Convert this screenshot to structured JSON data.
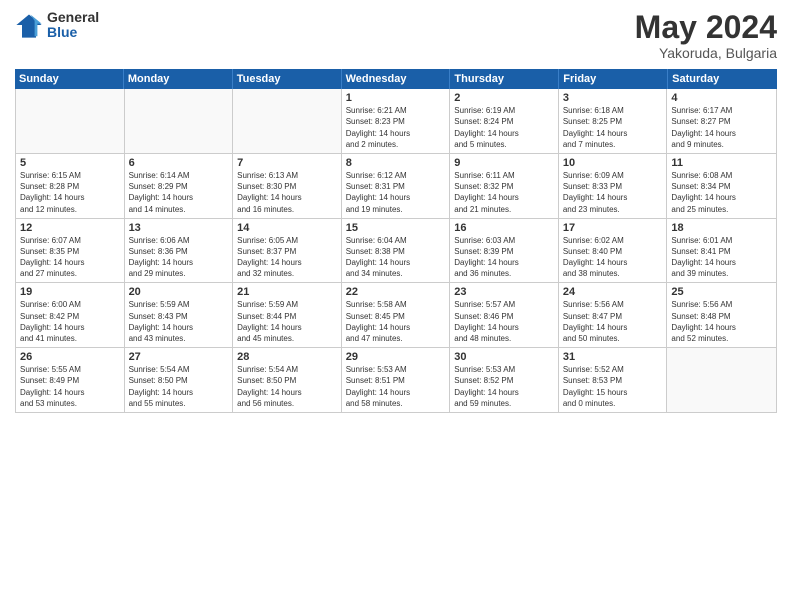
{
  "logo": {
    "general": "General",
    "blue": "Blue"
  },
  "title": "May 2024",
  "subtitle": "Yakoruda, Bulgaria",
  "days": [
    "Sunday",
    "Monday",
    "Tuesday",
    "Wednesday",
    "Thursday",
    "Friday",
    "Saturday"
  ],
  "weeks": [
    [
      {
        "day": "",
        "empty": true
      },
      {
        "day": "",
        "empty": true
      },
      {
        "day": "",
        "empty": true
      },
      {
        "day": "1",
        "line1": "Sunrise: 6:21 AM",
        "line2": "Sunset: 8:23 PM",
        "line3": "Daylight: 14 hours",
        "line4": "and 2 minutes."
      },
      {
        "day": "2",
        "line1": "Sunrise: 6:19 AM",
        "line2": "Sunset: 8:24 PM",
        "line3": "Daylight: 14 hours",
        "line4": "and 5 minutes."
      },
      {
        "day": "3",
        "line1": "Sunrise: 6:18 AM",
        "line2": "Sunset: 8:25 PM",
        "line3": "Daylight: 14 hours",
        "line4": "and 7 minutes."
      },
      {
        "day": "4",
        "line1": "Sunrise: 6:17 AM",
        "line2": "Sunset: 8:27 PM",
        "line3": "Daylight: 14 hours",
        "line4": "and 9 minutes."
      }
    ],
    [
      {
        "day": "5",
        "line1": "Sunrise: 6:15 AM",
        "line2": "Sunset: 8:28 PM",
        "line3": "Daylight: 14 hours",
        "line4": "and 12 minutes."
      },
      {
        "day": "6",
        "line1": "Sunrise: 6:14 AM",
        "line2": "Sunset: 8:29 PM",
        "line3": "Daylight: 14 hours",
        "line4": "and 14 minutes."
      },
      {
        "day": "7",
        "line1": "Sunrise: 6:13 AM",
        "line2": "Sunset: 8:30 PM",
        "line3": "Daylight: 14 hours",
        "line4": "and 16 minutes."
      },
      {
        "day": "8",
        "line1": "Sunrise: 6:12 AM",
        "line2": "Sunset: 8:31 PM",
        "line3": "Daylight: 14 hours",
        "line4": "and 19 minutes."
      },
      {
        "day": "9",
        "line1": "Sunrise: 6:11 AM",
        "line2": "Sunset: 8:32 PM",
        "line3": "Daylight: 14 hours",
        "line4": "and 21 minutes."
      },
      {
        "day": "10",
        "line1": "Sunrise: 6:09 AM",
        "line2": "Sunset: 8:33 PM",
        "line3": "Daylight: 14 hours",
        "line4": "and 23 minutes."
      },
      {
        "day": "11",
        "line1": "Sunrise: 6:08 AM",
        "line2": "Sunset: 8:34 PM",
        "line3": "Daylight: 14 hours",
        "line4": "and 25 minutes."
      }
    ],
    [
      {
        "day": "12",
        "line1": "Sunrise: 6:07 AM",
        "line2": "Sunset: 8:35 PM",
        "line3": "Daylight: 14 hours",
        "line4": "and 27 minutes."
      },
      {
        "day": "13",
        "line1": "Sunrise: 6:06 AM",
        "line2": "Sunset: 8:36 PM",
        "line3": "Daylight: 14 hours",
        "line4": "and 29 minutes."
      },
      {
        "day": "14",
        "line1": "Sunrise: 6:05 AM",
        "line2": "Sunset: 8:37 PM",
        "line3": "Daylight: 14 hours",
        "line4": "and 32 minutes."
      },
      {
        "day": "15",
        "line1": "Sunrise: 6:04 AM",
        "line2": "Sunset: 8:38 PM",
        "line3": "Daylight: 14 hours",
        "line4": "and 34 minutes."
      },
      {
        "day": "16",
        "line1": "Sunrise: 6:03 AM",
        "line2": "Sunset: 8:39 PM",
        "line3": "Daylight: 14 hours",
        "line4": "and 36 minutes."
      },
      {
        "day": "17",
        "line1": "Sunrise: 6:02 AM",
        "line2": "Sunset: 8:40 PM",
        "line3": "Daylight: 14 hours",
        "line4": "and 38 minutes."
      },
      {
        "day": "18",
        "line1": "Sunrise: 6:01 AM",
        "line2": "Sunset: 8:41 PM",
        "line3": "Daylight: 14 hours",
        "line4": "and 39 minutes."
      }
    ],
    [
      {
        "day": "19",
        "line1": "Sunrise: 6:00 AM",
        "line2": "Sunset: 8:42 PM",
        "line3": "Daylight: 14 hours",
        "line4": "and 41 minutes."
      },
      {
        "day": "20",
        "line1": "Sunrise: 5:59 AM",
        "line2": "Sunset: 8:43 PM",
        "line3": "Daylight: 14 hours",
        "line4": "and 43 minutes."
      },
      {
        "day": "21",
        "line1": "Sunrise: 5:59 AM",
        "line2": "Sunset: 8:44 PM",
        "line3": "Daylight: 14 hours",
        "line4": "and 45 minutes."
      },
      {
        "day": "22",
        "line1": "Sunrise: 5:58 AM",
        "line2": "Sunset: 8:45 PM",
        "line3": "Daylight: 14 hours",
        "line4": "and 47 minutes."
      },
      {
        "day": "23",
        "line1": "Sunrise: 5:57 AM",
        "line2": "Sunset: 8:46 PM",
        "line3": "Daylight: 14 hours",
        "line4": "and 48 minutes."
      },
      {
        "day": "24",
        "line1": "Sunrise: 5:56 AM",
        "line2": "Sunset: 8:47 PM",
        "line3": "Daylight: 14 hours",
        "line4": "and 50 minutes."
      },
      {
        "day": "25",
        "line1": "Sunrise: 5:56 AM",
        "line2": "Sunset: 8:48 PM",
        "line3": "Daylight: 14 hours",
        "line4": "and 52 minutes."
      }
    ],
    [
      {
        "day": "26",
        "line1": "Sunrise: 5:55 AM",
        "line2": "Sunset: 8:49 PM",
        "line3": "Daylight: 14 hours",
        "line4": "and 53 minutes."
      },
      {
        "day": "27",
        "line1": "Sunrise: 5:54 AM",
        "line2": "Sunset: 8:50 PM",
        "line3": "Daylight: 14 hours",
        "line4": "and 55 minutes."
      },
      {
        "day": "28",
        "line1": "Sunrise: 5:54 AM",
        "line2": "Sunset: 8:50 PM",
        "line3": "Daylight: 14 hours",
        "line4": "and 56 minutes."
      },
      {
        "day": "29",
        "line1": "Sunrise: 5:53 AM",
        "line2": "Sunset: 8:51 PM",
        "line3": "Daylight: 14 hours",
        "line4": "and 58 minutes."
      },
      {
        "day": "30",
        "line1": "Sunrise: 5:53 AM",
        "line2": "Sunset: 8:52 PM",
        "line3": "Daylight: 14 hours",
        "line4": "and 59 minutes."
      },
      {
        "day": "31",
        "line1": "Sunrise: 5:52 AM",
        "line2": "Sunset: 8:53 PM",
        "line3": "Daylight: 15 hours",
        "line4": "and 0 minutes."
      },
      {
        "day": "",
        "empty": true
      }
    ]
  ]
}
